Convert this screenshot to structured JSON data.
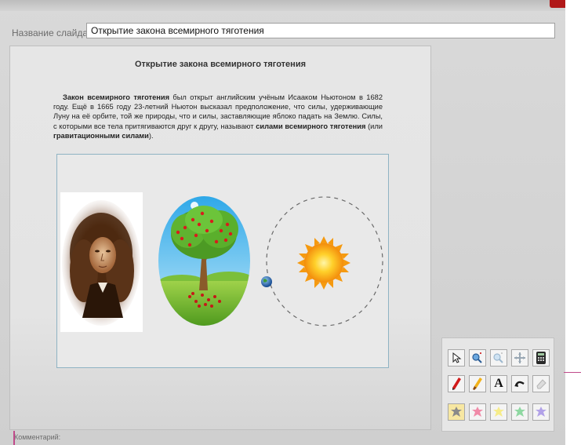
{
  "header": {
    "slide_name_label": "Название слайда:",
    "slide_name_value": "Открытие закона всемирного тяготения"
  },
  "slide": {
    "title": "Открытие закона всемирного тяготения",
    "body": {
      "term1": "Закон всемирного тяготения",
      "text1": " был открыт английским учёным Исааком Ньютоном в 1682 году. Ещё в 1665 году 23-летний Ньютон высказал предположение, что силы, удерживающие Луну на её орбите, той же природы, что и силы, заставляющие яблоко падать на Землю. Силы, с которыми все тела притягиваются друг к другу, называют ",
      "term2": "силами всемирного тяготения",
      "text2": " (или ",
      "term3": "гравитационными силами",
      "text3": ")."
    }
  },
  "illustrations": [
    {
      "icon": "newton-portrait"
    },
    {
      "icon": "apple-tree"
    },
    {
      "icon": "earth-orbit-sun"
    }
  ],
  "toolbox": {
    "tools": [
      {
        "name": "pointer-icon"
      },
      {
        "name": "zoom-in-icon"
      },
      {
        "name": "zoom-out-icon"
      },
      {
        "name": "move-icon"
      },
      {
        "name": "calculator-icon"
      },
      {
        "name": "red-pen-icon"
      },
      {
        "name": "highlighter-icon"
      },
      {
        "name": "text-icon",
        "label": "A"
      },
      {
        "name": "undo-icon"
      },
      {
        "name": "eraser-icon"
      },
      {
        "name": "stamp-gray-icon"
      },
      {
        "name": "stamp-pink-icon"
      },
      {
        "name": "stamp-yellow-icon"
      },
      {
        "name": "stamp-green-icon"
      },
      {
        "name": "stamp-purple-icon"
      }
    ]
  },
  "footer": {
    "label": "Комментарий:"
  },
  "colors": {
    "background": "#d9d9d9",
    "accent_line": "#c04a8a",
    "close_red": "#b01818"
  }
}
